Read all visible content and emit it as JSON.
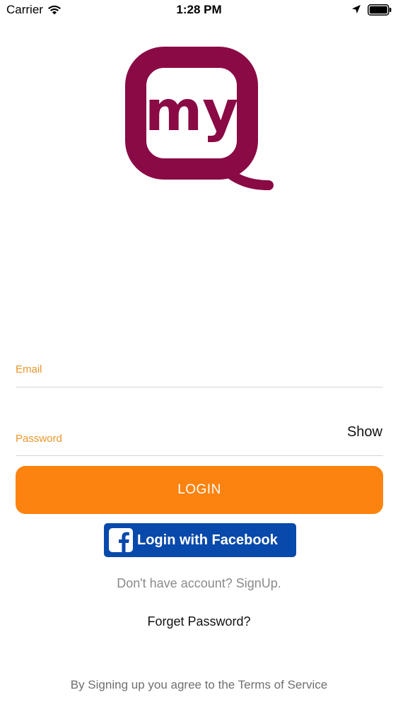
{
  "status_bar": {
    "carrier": "Carrier",
    "time": "1:28 PM",
    "wifi_icon": "wifi-icon",
    "location_icon": "location-arrow-icon",
    "battery_icon": "battery-icon"
  },
  "logo": {
    "text": "my",
    "letter": "Q",
    "color": "#8a0a45"
  },
  "form": {
    "email_label": "Email",
    "email_value": "",
    "password_label": "Password",
    "password_value": "",
    "show_label": "Show",
    "label_color": "#e8962b"
  },
  "actions": {
    "login_label": "LOGIN",
    "login_color": "#fc830f",
    "facebook_label": "Login with Facebook",
    "facebook_color": "#0849ac",
    "facebook_icon": "facebook-icon",
    "signup_text": "Don't have account? SignUp.",
    "forget_password_text": "Forget Password?"
  },
  "footer": {
    "terms_text": "By Signing up you agree to the Terms of Service"
  }
}
